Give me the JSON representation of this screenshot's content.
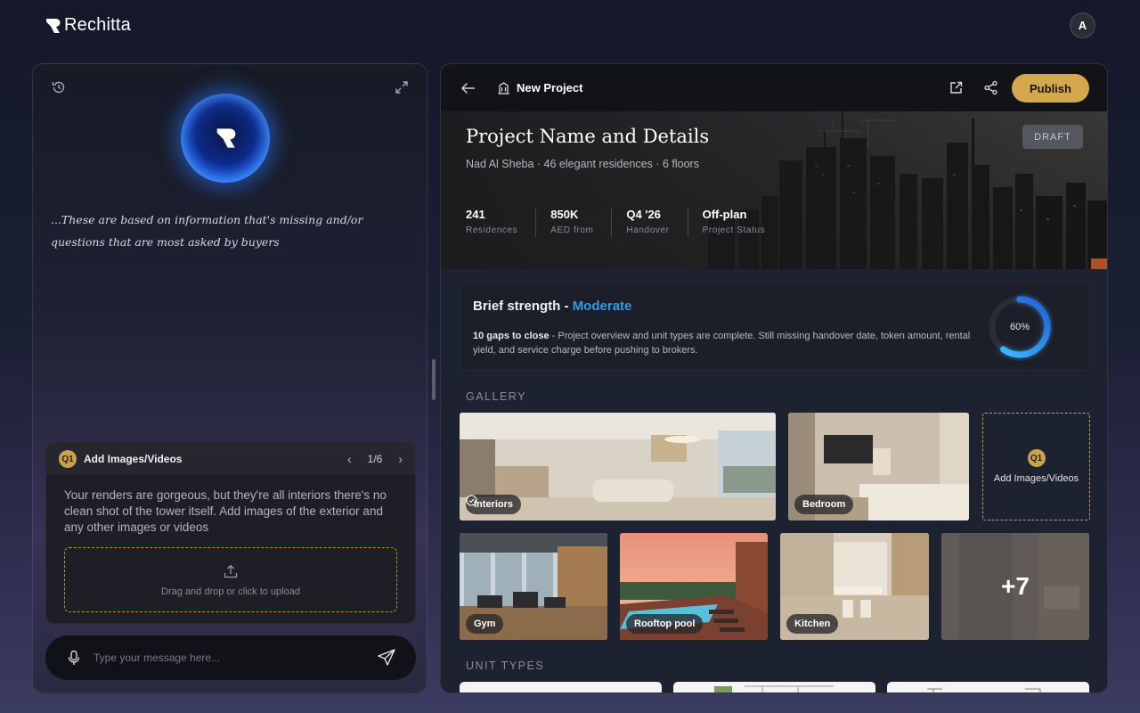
{
  "app": {
    "name": "Rechitta",
    "user_initial": "A"
  },
  "assistant": {
    "quote": "...These are based on information that's missing and/or questions that are most asked by buyers",
    "question": {
      "badge": "Q1",
      "title": "Add Images/Videos",
      "pager": "1/6",
      "text": "Your renders are gorgeous, but they're all interiors there's no clean shot of the tower itself. Add images of the exterior and any other images or videos",
      "upload_hint": "Drag and drop or click to upload"
    },
    "composer": {
      "placeholder": "Type your message here..."
    }
  },
  "project": {
    "header_title": "New Project",
    "publish_label": "Publish",
    "title": "Project Name and Details",
    "subtitle": "Nad Al Sheba · 46 elegant residences · 6 floors",
    "status_badge": "DRAFT",
    "stats": [
      {
        "value": "241",
        "label": "Residences"
      },
      {
        "value": "850K",
        "label": "AED from"
      },
      {
        "value": "Q4 '26",
        "label": "Handover"
      },
      {
        "value": "Off-plan",
        "label": "Project Status"
      }
    ],
    "strength": {
      "label": "Brief strength -",
      "level": "Moderate",
      "gaps": "10 gaps to close",
      "description": " - Project overview and unit types are complete. Still missing handover date, token amount, rental yield, and service charge before pushing to brokers.",
      "percent_label": "60%",
      "percent": 0.6
    },
    "gallery": {
      "label": "GALLERY",
      "tiles": [
        {
          "label": "Interiors"
        },
        {
          "label": "Bedroom"
        },
        {
          "label": "Gym"
        },
        {
          "label": "Rooftop pool"
        },
        {
          "label": "Kitchen"
        }
      ],
      "add_badge": "Q1",
      "add_label": "Add Images/Videos",
      "more_count": "+7"
    },
    "unit_types": {
      "label": "UNIT TYPES"
    }
  },
  "colors": {
    "accent_gold": "#d4a94e",
    "accent_blue": "#2e9de6"
  }
}
